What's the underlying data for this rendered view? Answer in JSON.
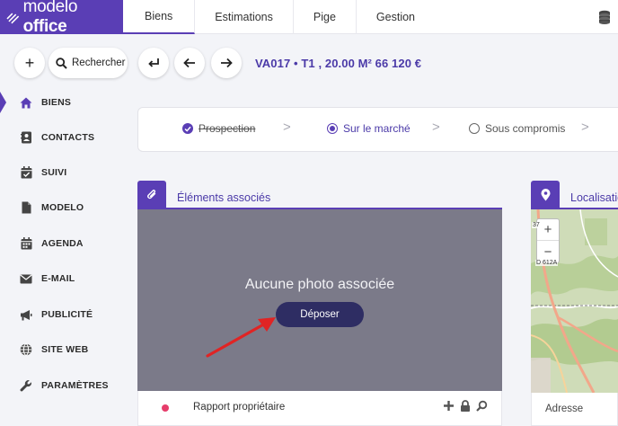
{
  "brand": {
    "light": "modelo ",
    "bold": "office"
  },
  "tabs": [
    "Biens",
    "Estimations",
    "Pige",
    "Gestion"
  ],
  "toolbar": {
    "add_label": "+",
    "search_label": "Rechercher",
    "reference": "VA017 • T1 , 20.00 M² 66 120 €"
  },
  "sidebar": {
    "items": [
      {
        "label": "BIENS",
        "icon": "home-icon"
      },
      {
        "label": "CONTACTS",
        "icon": "contact-card-icon"
      },
      {
        "label": "SUIVI",
        "icon": "calendar-check-icon"
      },
      {
        "label": "MODELO",
        "icon": "document-icon"
      },
      {
        "label": "AGENDA",
        "icon": "calendar-icon"
      },
      {
        "label": "E-MAIL",
        "icon": "envelope-icon"
      },
      {
        "label": "PUBLICITÉ",
        "icon": "megaphone-icon"
      },
      {
        "label": "SITE WEB",
        "icon": "globe-icon"
      },
      {
        "label": "PARAMÈTRES",
        "icon": "wrench-icon"
      }
    ]
  },
  "status": {
    "steps": [
      {
        "label": "Prospection",
        "state": "done"
      },
      {
        "label": "Sur le marché",
        "state": "current"
      },
      {
        "label": "Sous compromis",
        "state": "todo"
      }
    ],
    "separator": ">"
  },
  "elements": {
    "title": "Éléments associés",
    "empty_text": "Aucune photo associée",
    "upload_label": "Déposer",
    "documents": [
      {
        "label": "Rapport propriétaire",
        "status_color": "#e63d6b"
      }
    ]
  },
  "map": {
    "title": "Localisatio",
    "zoom_in": "+",
    "zoom_out": "−",
    "road_label": "D 612A",
    "number_label": "37",
    "address_label": "Adresse"
  },
  "colors": {
    "accent": "#5a3eb5",
    "accent_text": "#4b3aa8",
    "photo_zone": "#7b7a89",
    "upload_button": "#2e2d63",
    "arrow": "#e02424"
  }
}
